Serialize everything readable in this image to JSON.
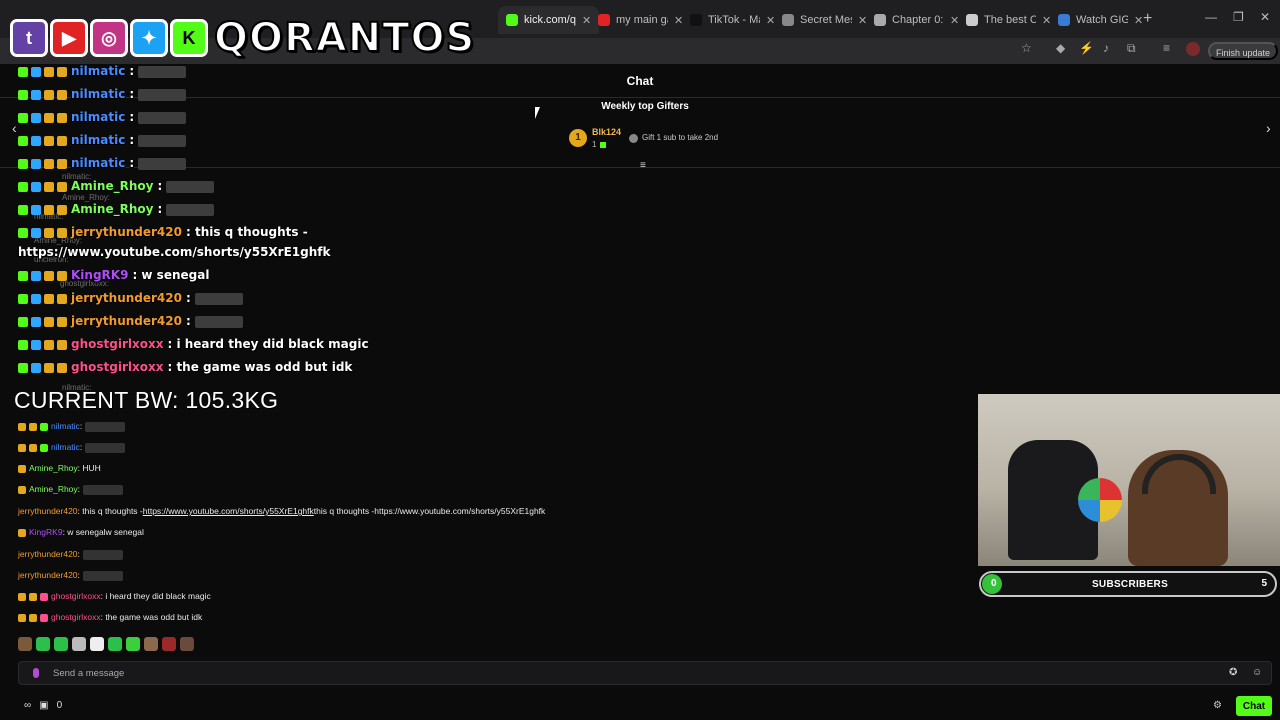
{
  "browser": {
    "tabs": [
      {
        "label": "kick.com/qo",
        "active": true,
        "fav_color": "#53fc18"
      },
      {
        "label": "my main ga",
        "active": false,
        "fav_color": "#e02424"
      },
      {
        "label": "TikTok - Mal",
        "active": false,
        "fav_color": "#111111"
      },
      {
        "label": "Secret Mess",
        "active": false,
        "fav_color": "#888888"
      },
      {
        "label": "Chapter 0: F",
        "active": false,
        "fav_color": "#aaaaaa"
      },
      {
        "label": "The best Ch",
        "active": false,
        "fav_color": "#cccccc"
      },
      {
        "label": "Watch GIGA",
        "active": false,
        "fav_color": "#3a7bd5"
      }
    ],
    "finish_update": "Finish update"
  },
  "brand": {
    "name": "QORANTOS",
    "icons": [
      "twitch-icon",
      "youtube-icon",
      "instagram-icon",
      "twitter-icon",
      "kick-icon"
    ]
  },
  "chat": {
    "title": "Chat",
    "gifters_title": "Weekly top Gifters",
    "top_gifter": {
      "rank": "1",
      "name": "Blk124",
      "count": "1"
    },
    "gift_hint": "Gift 1 sub to take 2nd"
  },
  "overlay_chat": [
    {
      "user": "nilmatic",
      "color": "#4a8cff",
      "text": ":",
      "emote": true
    },
    {
      "user": "nilmatic",
      "color": "#4a8cff",
      "text": ":",
      "emote": true
    },
    {
      "user": "nilmatic",
      "color": "#4a8cff",
      "text": ":",
      "emote": true
    },
    {
      "user": "nilmatic",
      "color": "#4a8cff",
      "text": ":",
      "emote": true
    },
    {
      "user": "nilmatic",
      "color": "#4a8cff",
      "text": ":",
      "emote": true
    },
    {
      "user": "Amine_Rhoy",
      "color": "#7dff5a",
      "text": ":",
      "emote": true
    },
    {
      "user": "Amine_Rhoy",
      "color": "#7dff5a",
      "text": ":",
      "emote": true
    },
    {
      "user": "jerrythunder420",
      "color": "#f39a2b",
      "text": ": this q thoughts -",
      "emote": false
    },
    {
      "user": "",
      "color": "#ffffff",
      "text": "https://www.youtube.com/shorts/y55XrE1ghfk",
      "emote": false
    },
    {
      "user": "KingRK9",
      "color": "#b24bff",
      "text": ": w senegal",
      "emote": false
    },
    {
      "user": "jerrythunder420",
      "color": "#f39a2b",
      "text": ":",
      "emote": true
    },
    {
      "user": "jerrythunder420",
      "color": "#f39a2b",
      "text": ":",
      "emote": true
    },
    {
      "user": "ghostgirlxoxx",
      "color": "#ff4f8b",
      "text": ": i heard they did black magic",
      "emote": false
    },
    {
      "user": "ghostgirlxoxx",
      "color": "#ff4f8b",
      "text": ": the game was odd but idk",
      "emote": false
    }
  ],
  "ghost_texts": [
    "nilmatic:",
    "Amine_Rhoy:",
    "nilmatic:",
    "Amine_Rhoy:",
    "unclelron:",
    "ghostgirlxoxx:",
    "nilmatic:"
  ],
  "body_weight": "CURRENT BW: 105.3KG",
  "native_chat": [
    {
      "user": "nilmatic",
      "color": "#4a8cff",
      "text": ":",
      "emote": true
    },
    {
      "user": "nilmatic",
      "color": "#4a8cff",
      "text": ":",
      "emote": true
    },
    {
      "user": "Amine_Rhoy",
      "color": "#7dff5a",
      "text": ": HUH",
      "emote": false
    },
    {
      "user": "Amine_Rhoy",
      "color": "#7dff5a",
      "text": ":",
      "emote": true
    },
    {
      "user": "jerrythunder420",
      "color": "#f39a2b",
      "text": ": this q thoughts -",
      "link": "https://www.youtube.com/shorts/y55XrE1ghfk",
      "suffix": "this q thoughts -https://www.youtube.com/shorts/y55XrE1ghfk"
    },
    {
      "user": "KingRK9",
      "color": "#b24bff",
      "text": ": w senegalw senegal",
      "emote": false
    },
    {
      "user": "jerrythunder420",
      "color": "#f39a2b",
      "text": ":",
      "emote": true
    },
    {
      "user": "jerrythunder420",
      "color": "#f39a2b",
      "text": ":",
      "emote": true
    },
    {
      "user": "ghostgirlxoxx",
      "color": "#ff4f8b",
      "text": ": i heard they did black magic",
      "emote": false
    },
    {
      "user": "ghostgirlxoxx",
      "color": "#ff4f8b",
      "text": ": the game was odd but idk",
      "emote": false
    }
  ],
  "input": {
    "placeholder": "Send a message"
  },
  "footer": {
    "viewer_count": "0",
    "chat_button": "Chat"
  },
  "subscribers": {
    "label": "SUBSCRIBERS",
    "current": "0",
    "goal": "5",
    "progress": 0.0
  },
  "colors": {
    "kick_green": "#53fc18",
    "accent_gold": "#e3a81c"
  }
}
